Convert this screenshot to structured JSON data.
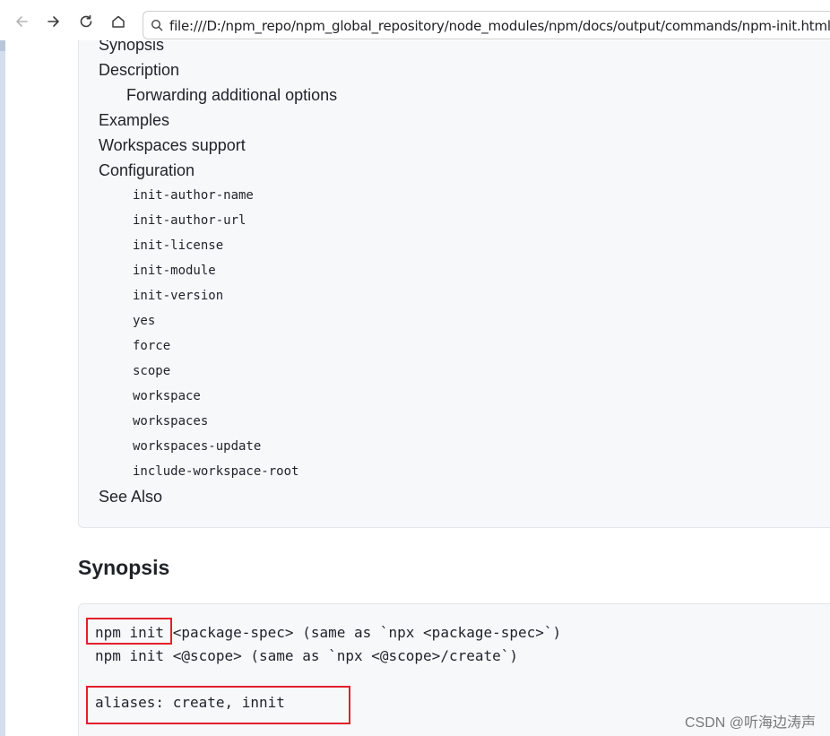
{
  "browser": {
    "url": "file:///D:/npm_repo/npm_global_repository/node_modules/npm/docs/output/commands/npm-init.html"
  },
  "toc": {
    "items_top": [
      "Synopsis",
      "Description",
      "Forwarding additional options",
      "Examples",
      "Workspaces support",
      "Configuration"
    ],
    "config_items": [
      "init-author-name",
      "init-author-url",
      "init-license",
      "init-module",
      "init-version",
      "yes",
      "force",
      "scope",
      "workspace",
      "workspaces",
      "workspaces-update",
      "include-workspace-root"
    ],
    "see_also": "See Also"
  },
  "synopsis": {
    "heading": "Synopsis",
    "line1_cmd": "npm init",
    "line1_rest": " <package-spec> (same as `npx <package-spec>`)",
    "line2": "npm init <@scope> (same as `npx <@scope>/create`)",
    "aliases": "aliases: create, innit"
  },
  "watermark": "CSDN @听海边涛声",
  "colors": {
    "highlight_box": "#e3202b",
    "panel_bg": "#f6f8fa"
  }
}
